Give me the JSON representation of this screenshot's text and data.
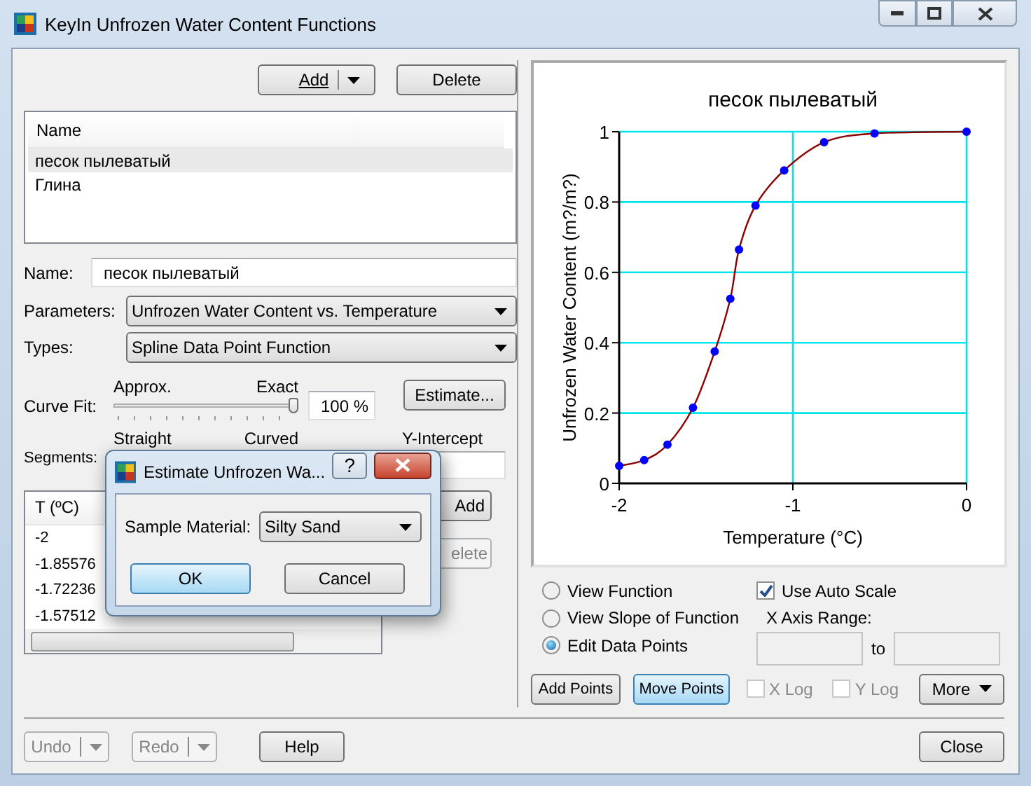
{
  "window": {
    "title": "KeyIn Unfrozen Water Content Functions"
  },
  "functions": {
    "add_button": "Add",
    "delete_button": "Delete",
    "list_header": "Name",
    "items": [
      {
        "label": "песок пылеватый",
        "selected": true
      },
      {
        "label": "Глина",
        "selected": false
      }
    ]
  },
  "name_field": {
    "label": "Name:",
    "value": "песок пылеватый"
  },
  "parameters": {
    "label": "Parameters:",
    "value": "Unfrozen Water Content vs. Temperature"
  },
  "types": {
    "label": "Types:",
    "value": "Spline Data Point Function"
  },
  "curve_fit": {
    "label": "Curve Fit:",
    "min_label": "Approx.",
    "max_label": "Exact",
    "level": 1,
    "value": "100 %"
  },
  "estimate_button": "Estimate...",
  "segments": {
    "label": "Segments:",
    "min_label": "Straight",
    "max_label": "Curved"
  },
  "y_intercept": {
    "label": "Y-Intercept"
  },
  "points_table": {
    "columns": [
      "T (ºC)"
    ],
    "rows": [
      "-2",
      "-1.85576",
      "-1.72236",
      "-1.57512"
    ]
  },
  "point_buttons": [
    {
      "label": "Add",
      "disabled": false
    },
    {
      "label": "elete",
      "disabled": true
    }
  ],
  "dialog": {
    "title": "Estimate Unfrozen Wa...",
    "help": "?",
    "field_label": "Sample Material:",
    "value": "Silty Sand",
    "ok": "OK",
    "cancel": "Cancel"
  },
  "chart": {
    "chart_data": {
      "type": "line",
      "title": "песок пылеватый",
      "xlabel": "Temperature (°C)",
      "ylabel": "Unfrozen Water Content (m?/m?)",
      "xlim": [
        -2,
        0
      ],
      "ylim": [
        0,
        1
      ],
      "xticks": [
        -2,
        -1,
        0
      ],
      "yticks": [
        0,
        0.2,
        0.4,
        0.6,
        0.8,
        1
      ],
      "grid": true,
      "x": [
        -2,
        -1.856,
        -1.722,
        -1.575,
        -1.45,
        -1.36,
        -1.31,
        -1.215,
        -1.05,
        -0.82,
        -0.53,
        0
      ],
      "series": [
        {
          "color": "#0000ff",
          "marker": "circle",
          "values": [
            0.05,
            0.066,
            0.11,
            0.215,
            0.375,
            0.525,
            0.665,
            0.79,
            0.89,
            0.97,
            0.995,
            1
          ]
        }
      ]
    }
  },
  "view_options": [
    {
      "label": "View Function",
      "selected": false
    },
    {
      "label": "View Slope of Function",
      "selected": false
    },
    {
      "label": "Edit Data Points",
      "selected": true
    }
  ],
  "auto_scale": {
    "label": "Use Auto Scale",
    "checked": true
  },
  "x_axis_range": {
    "label": "X Axis Range:",
    "to": "to"
  },
  "mode_buttons": [
    {
      "label": "Add Points",
      "selected": false
    },
    {
      "label": "Move Points",
      "selected": true
    }
  ],
  "log_options": [
    {
      "label": "X Log",
      "checked": false,
      "disabled": true
    },
    {
      "label": "Y Log",
      "checked": false,
      "disabled": true
    }
  ],
  "more_button": "More",
  "footer": {
    "undo": {
      "label": "Undo",
      "disabled": true
    },
    "redo": {
      "label": "Redo",
      "disabled": true
    },
    "help": "Help",
    "close": "Close"
  }
}
